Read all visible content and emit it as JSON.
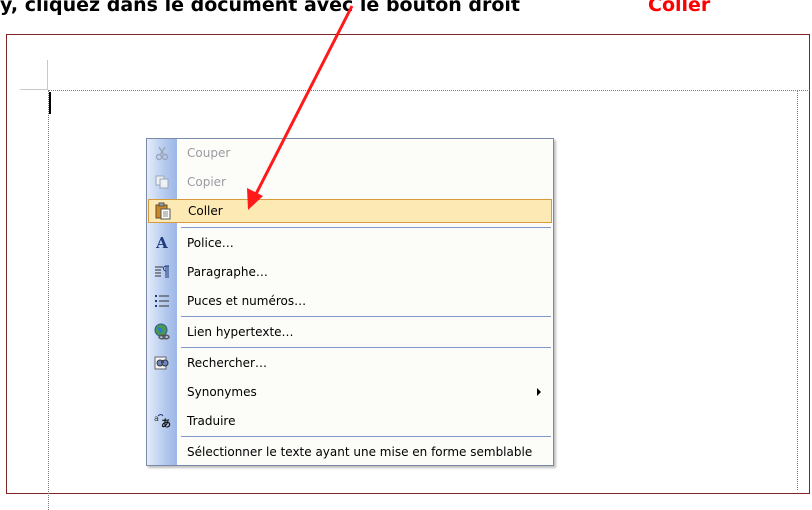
{
  "caption": {
    "lead": "y, cliquez dans le document avec le bouton droit",
    "highlight": "Coller"
  },
  "colors": {
    "accent_arrow": "#ff0000",
    "frame_border": "#7f2424",
    "menu_highlight": "#fde9b4",
    "menu_gutter": "#b4c9ee"
  },
  "context_menu": {
    "items": [
      {
        "label": "Couper",
        "icon": "scissors-icon",
        "state": "disabled"
      },
      {
        "label": "Copier",
        "icon": "copy-icon",
        "state": "disabled"
      },
      {
        "label": "Coller",
        "icon": "paste-clipboard-icon",
        "state": "highlighted"
      },
      {
        "label": "Police…",
        "icon": "font-icon",
        "state": "enabled"
      },
      {
        "label": "Paragraphe…",
        "icon": "paragraph-icon",
        "state": "enabled"
      },
      {
        "label": "Puces et numéros…",
        "icon": "bullets-icon",
        "state": "enabled"
      },
      {
        "label": "Lien hypertexte…",
        "icon": "hyperlink-globe-icon",
        "state": "enabled"
      },
      {
        "label": "Rechercher…",
        "icon": "research-binoculars-icon",
        "state": "enabled"
      },
      {
        "label": "Synonymes",
        "icon": "",
        "state": "enabled",
        "submenu": true
      },
      {
        "label": "Traduire",
        "icon": "translate-icon",
        "state": "enabled"
      },
      {
        "label": "Sélectionner le texte ayant une mise en forme semblable",
        "icon": "",
        "state": "enabled"
      }
    ]
  }
}
